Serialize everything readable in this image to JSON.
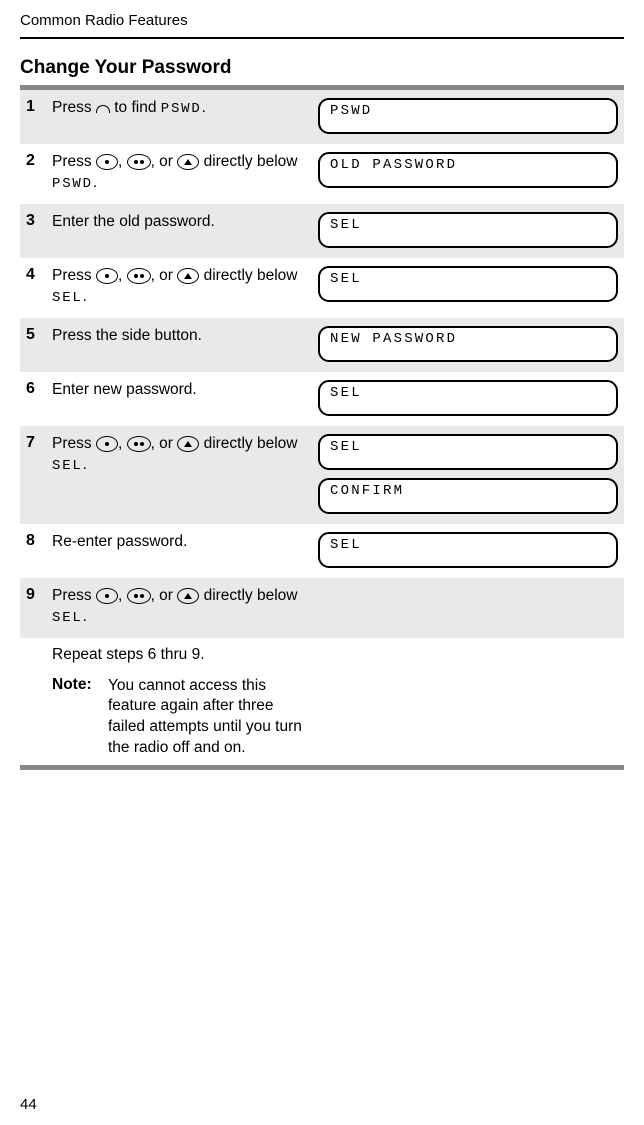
{
  "header": "Common Radio Features",
  "title": "Change Your Password",
  "steps": {
    "s1": {
      "num": "1",
      "pre": "Press ",
      "post": " to find ",
      "code": "PSWD",
      "end": ".",
      "displays": [
        "PSWD"
      ]
    },
    "s2": {
      "num": "2",
      "pre": "Press ",
      "mid": ", ",
      "mid2": ", or ",
      "post": " directly below ",
      "code": "PSWD",
      "end": ".",
      "displays": [
        "OLD PASSWORD"
      ]
    },
    "s3": {
      "num": "3",
      "text": "Enter the old password.",
      "displays": [
        "SEL"
      ]
    },
    "s4": {
      "num": "4",
      "pre": "Press ",
      "mid": ", ",
      "mid2": ", or ",
      "post": " directly below ",
      "code": "SEL",
      "end": ".",
      "displays": [
        "SEL"
      ]
    },
    "s5": {
      "num": "5",
      "text": "Press the side button.",
      "displays": [
        "NEW PASSWORD"
      ]
    },
    "s6": {
      "num": "6",
      "text": "Enter new password.",
      "displays": [
        "SEL"
      ]
    },
    "s7": {
      "num": "7",
      "pre": "Press ",
      "mid": ", ",
      "mid2": ", or ",
      "post": " directly below ",
      "code": "SEL",
      "end": ".",
      "displays": [
        "SEL",
        "CONFIRM"
      ]
    },
    "s8": {
      "num": "8",
      "text": "Re-enter password.",
      "displays": [
        "SEL"
      ]
    },
    "s9": {
      "num": "9",
      "pre": "Press ",
      "mid": ", ",
      "mid2": ", or ",
      "post": " directly below ",
      "code": "SEL",
      "end": "."
    }
  },
  "repeat": "Repeat steps 6 thru 9.",
  "note": {
    "label": "Note:",
    "text": "You cannot access this feature again after three failed attempts until you turn the radio off and on."
  },
  "page": "44"
}
